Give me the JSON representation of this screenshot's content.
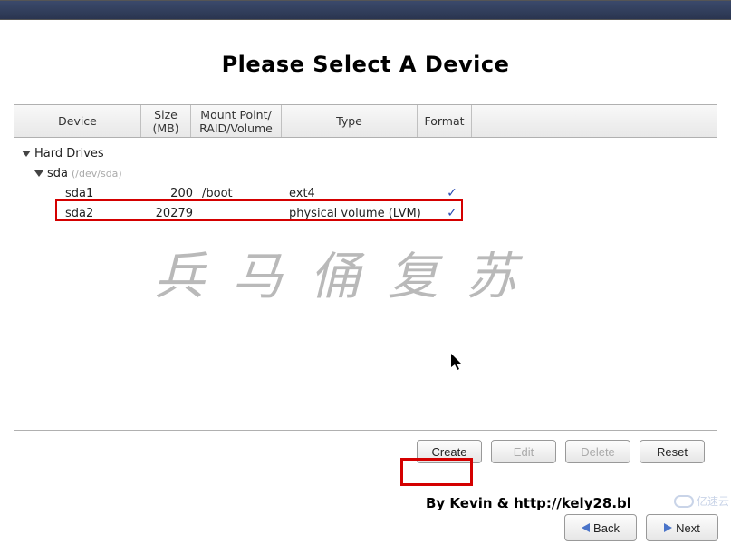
{
  "title": "Please Select A Device",
  "columns": {
    "device": "Device",
    "size": "Size\n(MB)",
    "mount": "Mount Point/\nRAID/Volume",
    "type": "Type",
    "format": "Format"
  },
  "tree": {
    "root_label": "Hard Drives",
    "disk": {
      "name": "sda",
      "path": "(/dev/sda)"
    },
    "partitions": [
      {
        "name": "sda1",
        "size": "200",
        "mount": "/boot",
        "type": "ext4",
        "format": true
      },
      {
        "name": "sda2",
        "size": "20279",
        "mount": "",
        "type": "physical volume (LVM)",
        "format": true
      }
    ]
  },
  "buttons": {
    "create": "Create",
    "edit": "Edit",
    "delete": "Delete",
    "reset": "Reset",
    "back": "Back",
    "next": "Next"
  },
  "watermark": "兵马俑复苏",
  "byline": "By Kevin & http://kely28.bl",
  "corner_logo": "亿速云"
}
